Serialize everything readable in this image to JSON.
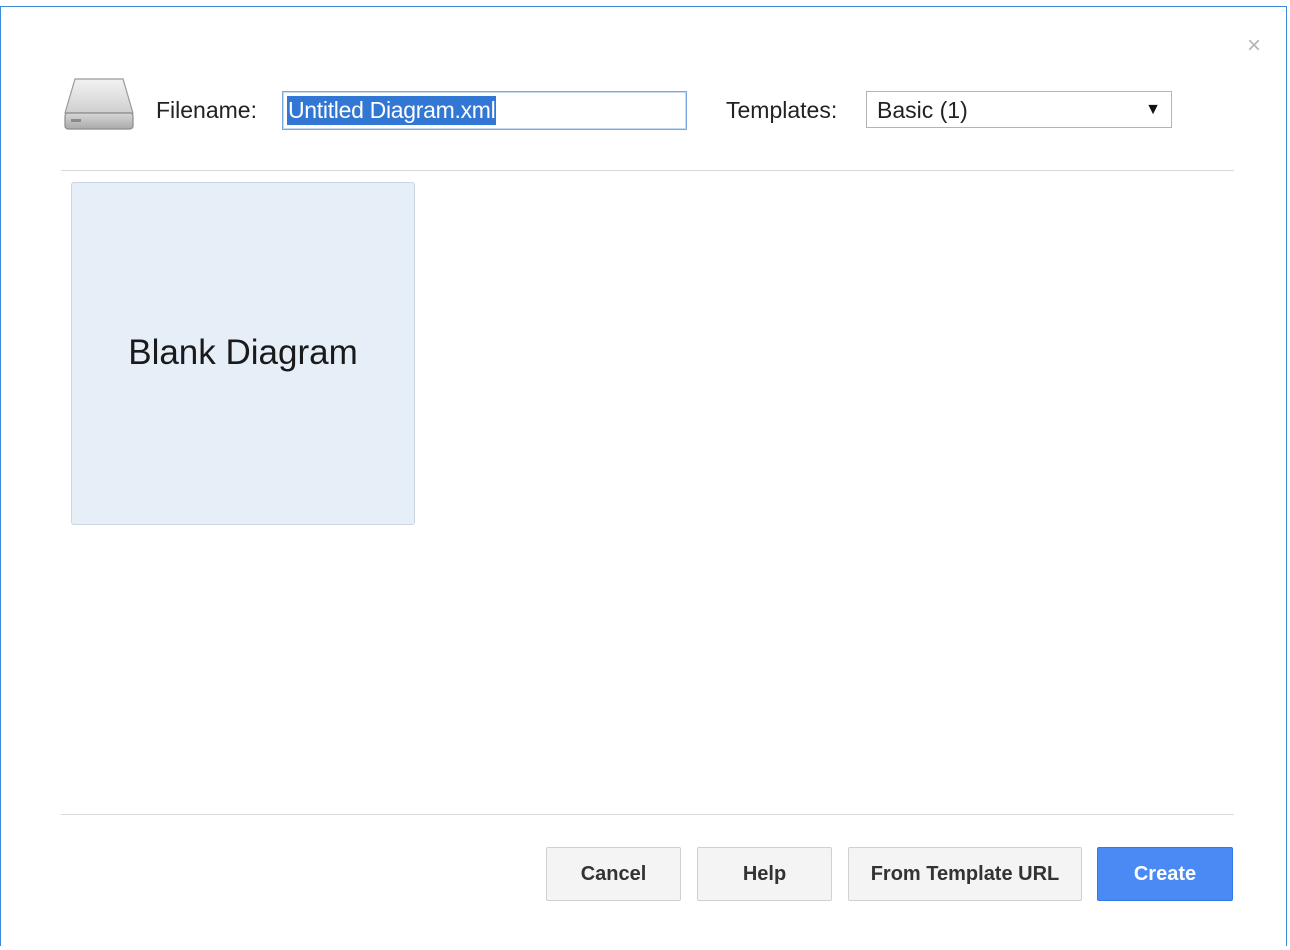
{
  "dialog": {
    "close_glyph": "×",
    "drive_icon": "hard-drive-icon"
  },
  "filename": {
    "label": "Filename:",
    "value": "Untitled Diagram.xml"
  },
  "templates": {
    "label": "Templates:",
    "selected": "Basic (1)",
    "arrow_glyph": "▼"
  },
  "tiles": [
    {
      "label": "Blank Diagram"
    }
  ],
  "buttons": {
    "cancel": "Cancel",
    "help": "Help",
    "from_template_url": "From Template URL",
    "create": "Create"
  },
  "colors": {
    "accent": "#4a8af4",
    "selection": "#3277d3",
    "tile_background": "#e6eef8",
    "dialog_border": "#3c8bd9"
  }
}
